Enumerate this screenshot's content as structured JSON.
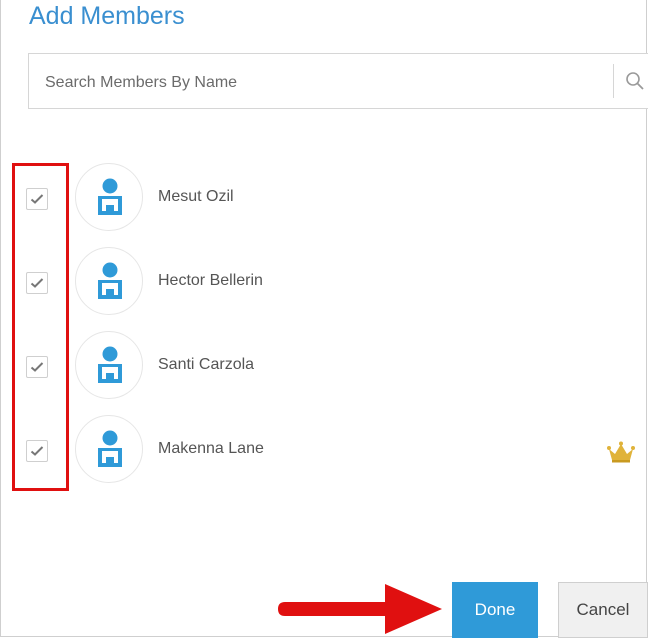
{
  "dialog": {
    "title": "Add Members"
  },
  "search": {
    "placeholder": "Search Members By Name",
    "value": "",
    "icon": "search-icon"
  },
  "members": [
    {
      "name": "Mesut Ozil",
      "checked": true,
      "owner": false
    },
    {
      "name": "Hector Bellerin",
      "checked": true,
      "owner": false
    },
    {
      "name": "Santi Carzola",
      "checked": true,
      "owner": false
    },
    {
      "name": "Makenna Lane",
      "checked": true,
      "owner": true,
      "badge_icon": "crown-icon"
    }
  ],
  "actions": {
    "done_label": "Done",
    "cancel_label": "Cancel"
  },
  "colors": {
    "accent": "#2f9ad8",
    "title": "#3a8fd0",
    "highlight": "#e01010",
    "crown": "#e0b33a"
  }
}
